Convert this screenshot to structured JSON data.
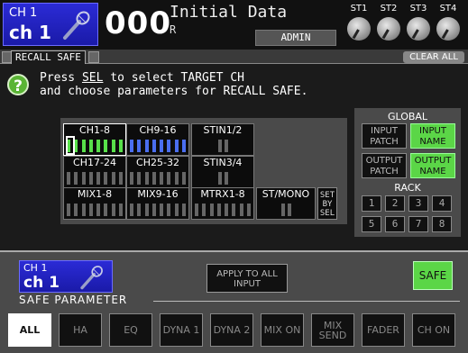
{
  "header": {
    "channel_number": "CH 1",
    "channel_name": "ch 1",
    "scene_number": "000",
    "scene_title": "Initial Data",
    "scene_flag": "R",
    "user": "ADMIN",
    "stereo_returns": [
      "ST1",
      "ST2",
      "ST3",
      "ST4"
    ]
  },
  "tabs": {
    "active_label": "RECALL SAFE",
    "clear_all_label": "CLEAR ALL"
  },
  "help": {
    "icon": "question-mark-icon",
    "line1_pre": "Press ",
    "line1_key": "SEL",
    "line1_post": " to select TARGET CH",
    "line2": "and choose parameters for RECALL SAFE."
  },
  "channel_groups": [
    {
      "label": "CH1-8",
      "bars": 8,
      "state": "green"
    },
    {
      "label": "CH9-16",
      "bars": 8,
      "state": "blue"
    },
    {
      "label": "STIN1/2",
      "bars": 2,
      "state": "off"
    },
    {
      "label": "CH17-24",
      "bars": 8,
      "state": "off"
    },
    {
      "label": "CH25-32",
      "bars": 8,
      "state": "off"
    },
    {
      "label": "STIN3/4",
      "bars": 2,
      "state": "off"
    },
    {
      "label": "MIX1-8",
      "bars": 8,
      "state": "off"
    },
    {
      "label": "MIX9-16",
      "bars": 8,
      "state": "off"
    },
    {
      "label": "MTRX1-8",
      "bars": 8,
      "state": "off"
    },
    {
      "label": "ST/MONO",
      "bars": 2,
      "state": "off"
    }
  ],
  "set_by_sel": "SET BY SEL",
  "global": {
    "title": "GLOBAL",
    "input_patch": "INPUT PATCH",
    "input_name": "INPUT NAME",
    "output_patch": "OUTPUT PATCH",
    "output_name": "OUTPUT NAME"
  },
  "rack": {
    "title": "RACK",
    "items": [
      "1",
      "2",
      "3",
      "4",
      "5",
      "6",
      "7",
      "8"
    ]
  },
  "bottom": {
    "channel_number": "CH 1",
    "channel_name": "ch 1",
    "apply_label": "APPLY TO ALL INPUT",
    "safe_label": "SAFE",
    "safe_parameter_label": "SAFE PARAMETER",
    "params": [
      "ALL",
      "HA",
      "EQ",
      "DYNA 1",
      "DYNA 2",
      "MIX ON",
      "MIX SEND",
      "FADER",
      "CH ON"
    ]
  },
  "colors": {
    "accent_green": "#5bd647",
    "channel_blue": "#2b2bd6",
    "bar_green": "#58e04a",
    "bar_blue": "#4a6ef0"
  }
}
